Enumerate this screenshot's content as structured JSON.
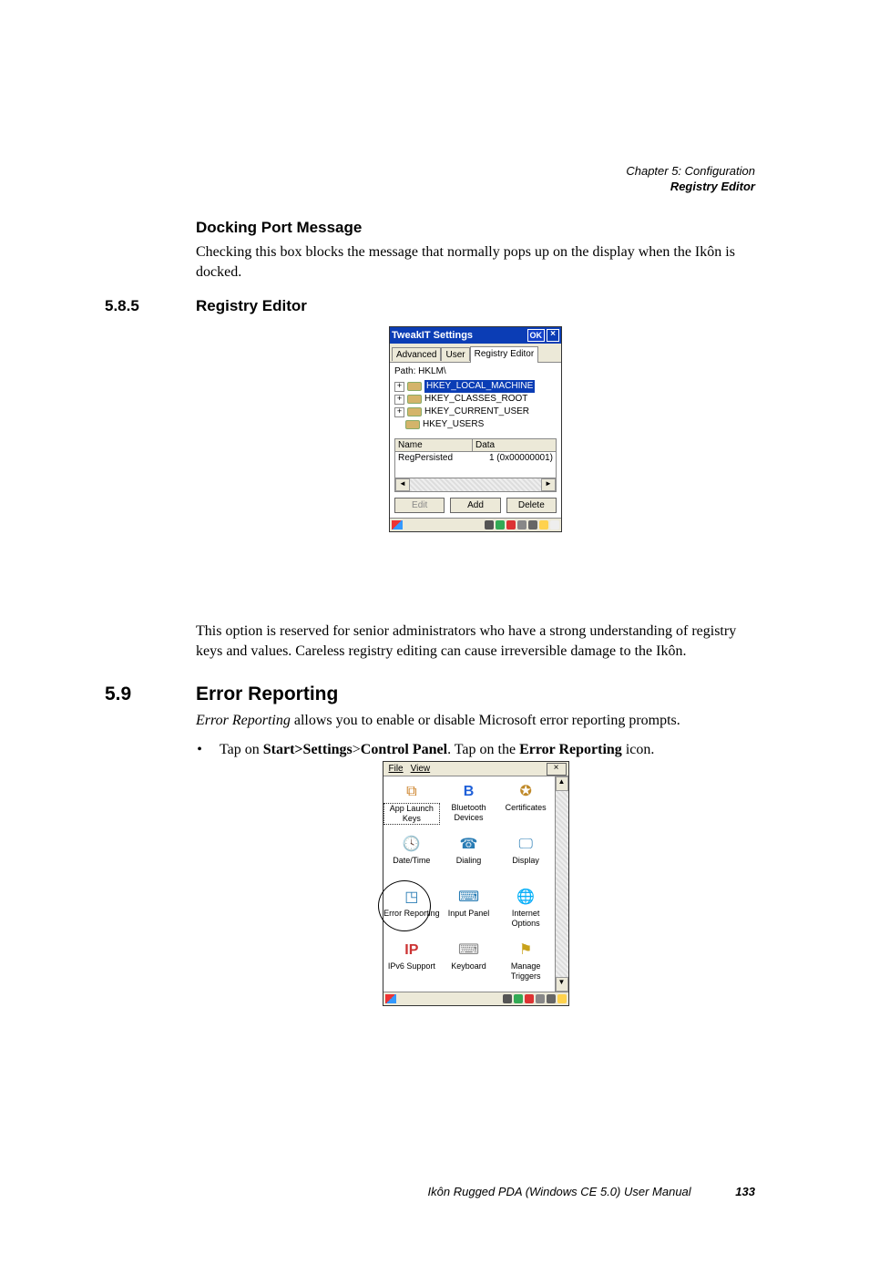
{
  "header": {
    "line1": "Chapter 5:  Configuration",
    "line2": "Registry Editor"
  },
  "section1": {
    "heading": "Docking Port Message",
    "body": "Checking this box blocks the message that normally pops up on the display when the Ikôn is docked."
  },
  "section2": {
    "num": "5.8.5",
    "heading": "Registry Editor",
    "after": "This option is reserved for senior administrators who have a strong understanding of registry keys and values. Careless registry editing can cause irreversible damage to the Ikôn."
  },
  "tweakit": {
    "title": "TweakIT Settings",
    "ok": "OK",
    "close": "×",
    "tabs": [
      "Advanced",
      "User",
      "Registry Editor"
    ],
    "path_label": "Path: HKLM\\",
    "tree": {
      "n0": "HKEY_LOCAL_MACHINE",
      "n1": "HKEY_CLASSES_ROOT",
      "n2": "HKEY_CURRENT_USER",
      "n3": "HKEY_USERS"
    },
    "grid": {
      "col_name": "Name",
      "col_data": "Data",
      "row_name": "RegPersisted",
      "row_data": "1 (0x00000001)"
    },
    "btn_edit": "Edit",
    "btn_add": "Add",
    "btn_delete": "Delete"
  },
  "section3": {
    "num": "5.9",
    "heading": "Error Reporting",
    "intro_prefix": "Error Reporting",
    "intro_rest": " allows you to enable or disable Microsoft error reporting prompts.",
    "bullet_parts": {
      "p1": "Tap on ",
      "p2": "Start>Settings",
      "p3": ">",
      "p4": "Control Panel",
      "p5": ". Tap on the ",
      "p6": "Error Reporting",
      "p7": " icon."
    }
  },
  "cpl": {
    "menu_file": "File",
    "menu_view": "View",
    "close": "×",
    "items": {
      "i0": "App Launch Keys",
      "i1": "Bluetooth Devices",
      "i2": "Certificates",
      "i3": "Date/Time",
      "i4": "Dialing",
      "i5": "Display",
      "i6": "Error Reporting",
      "i7": "Input Panel",
      "i8": "Internet Options",
      "i9": "IPv6 Support",
      "i10": "Keyboard",
      "i11": "Manage Triggers"
    }
  },
  "footer": {
    "text": "Ikôn Rugged PDA (Windows CE 5.0) User Manual",
    "page": "133"
  }
}
